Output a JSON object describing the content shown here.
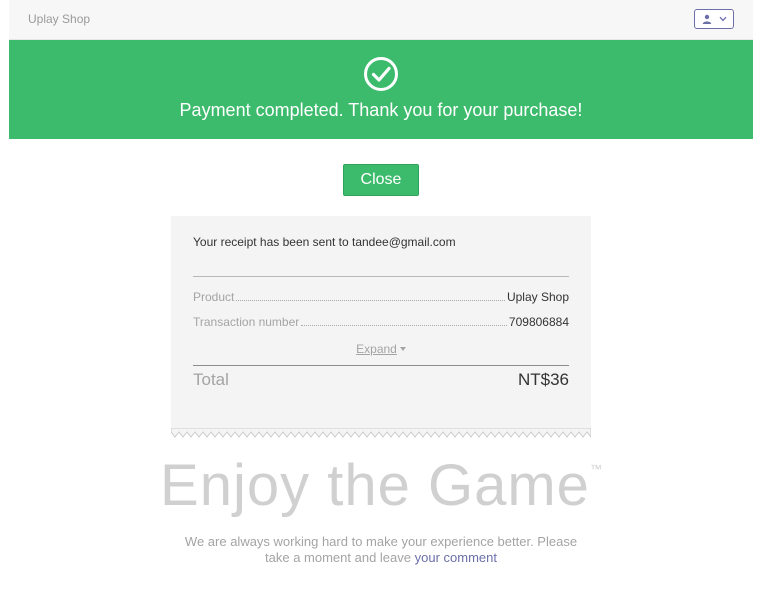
{
  "header": {
    "brand": "Uplay Shop",
    "account_icon": "person-icon",
    "dropdown_icon": "chevron-down-icon"
  },
  "banner": {
    "icon": "checkmark-circle-icon",
    "message": "Payment completed. Thank you for your purchase!",
    "color": "#3dbb6d"
  },
  "close_label": "Close",
  "receipt": {
    "sent_text": "Your receipt has been sent to tandee@gmail.com",
    "product_key": "Product",
    "product_value": "Uplay Shop",
    "transaction_key": "Transaction number",
    "transaction_value": "709806884",
    "expand_label": "Expand",
    "total_key": "Total",
    "total_value": "NT$36"
  },
  "enjoy": {
    "text": "Enjoy the Game",
    "tm": "™"
  },
  "footer": {
    "message": "We are always working hard to make your experience better. Please take a moment and leave ",
    "link": "your comment"
  },
  "accent_link_color": "#6b6fa8"
}
